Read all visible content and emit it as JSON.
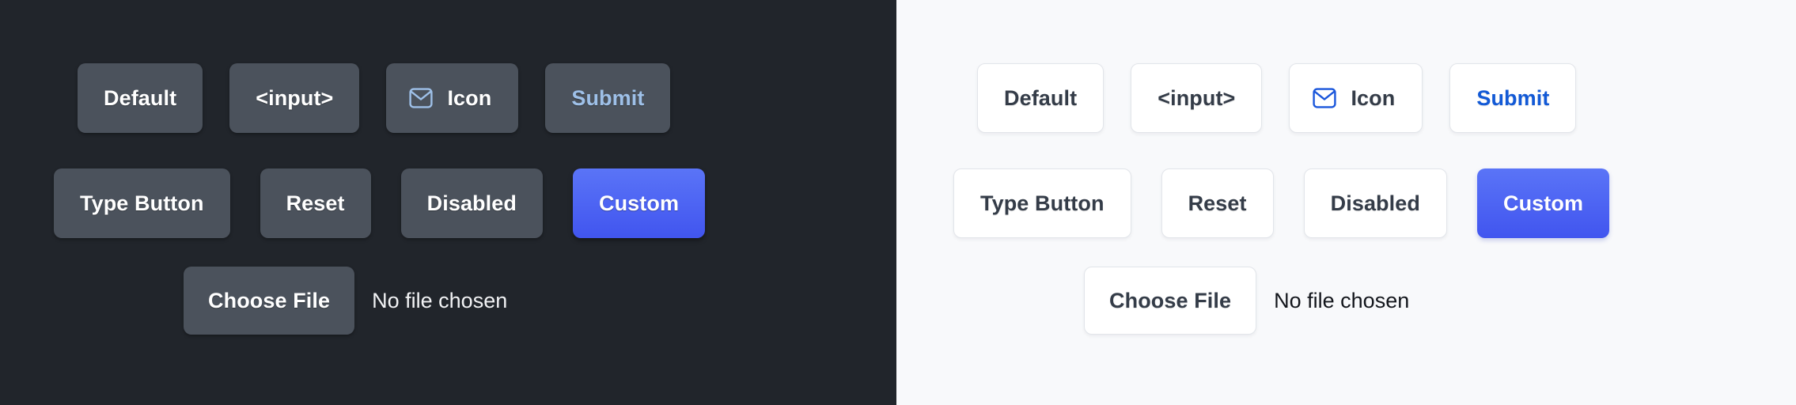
{
  "panels": [
    {
      "theme": "dark",
      "background_color": "#21252b",
      "button_color": "#4b525c",
      "text_color": "#ffffff",
      "accent_color": "#9ec0e8",
      "custom_color": "#4f66f4",
      "rows": [
        {
          "buttons": [
            {
              "label": "Default",
              "kind": "default"
            },
            {
              "label": "<input>",
              "kind": "input"
            },
            {
              "label": "Icon",
              "kind": "icon",
              "icon": "envelope-icon"
            },
            {
              "label": "Submit",
              "kind": "submit"
            }
          ]
        },
        {
          "buttons": [
            {
              "label": "Type Button",
              "kind": "type-button"
            },
            {
              "label": "Reset",
              "kind": "reset"
            },
            {
              "label": "Disabled",
              "kind": "disabled"
            },
            {
              "label": "Custom",
              "kind": "custom"
            }
          ]
        }
      ],
      "file_input": {
        "button_label": "Choose File",
        "status_text": "No file chosen"
      }
    },
    {
      "theme": "light",
      "background_color": "#f8f9fb",
      "button_color": "#ffffff",
      "border_color": "#e2e5ea",
      "text_color": "#343c48",
      "accent_color": "#1a56db",
      "custom_color": "#4f66f4",
      "rows": [
        {
          "buttons": [
            {
              "label": "Default",
              "kind": "default"
            },
            {
              "label": "<input>",
              "kind": "input"
            },
            {
              "label": "Icon",
              "kind": "icon",
              "icon": "envelope-icon"
            },
            {
              "label": "Submit",
              "kind": "submit"
            }
          ]
        },
        {
          "buttons": [
            {
              "label": "Type Button",
              "kind": "type-button"
            },
            {
              "label": "Reset",
              "kind": "reset"
            },
            {
              "label": "Disabled",
              "kind": "disabled"
            },
            {
              "label": "Custom",
              "kind": "custom"
            }
          ]
        }
      ],
      "file_input": {
        "button_label": "Choose File",
        "status_text": "No file chosen"
      }
    }
  ]
}
